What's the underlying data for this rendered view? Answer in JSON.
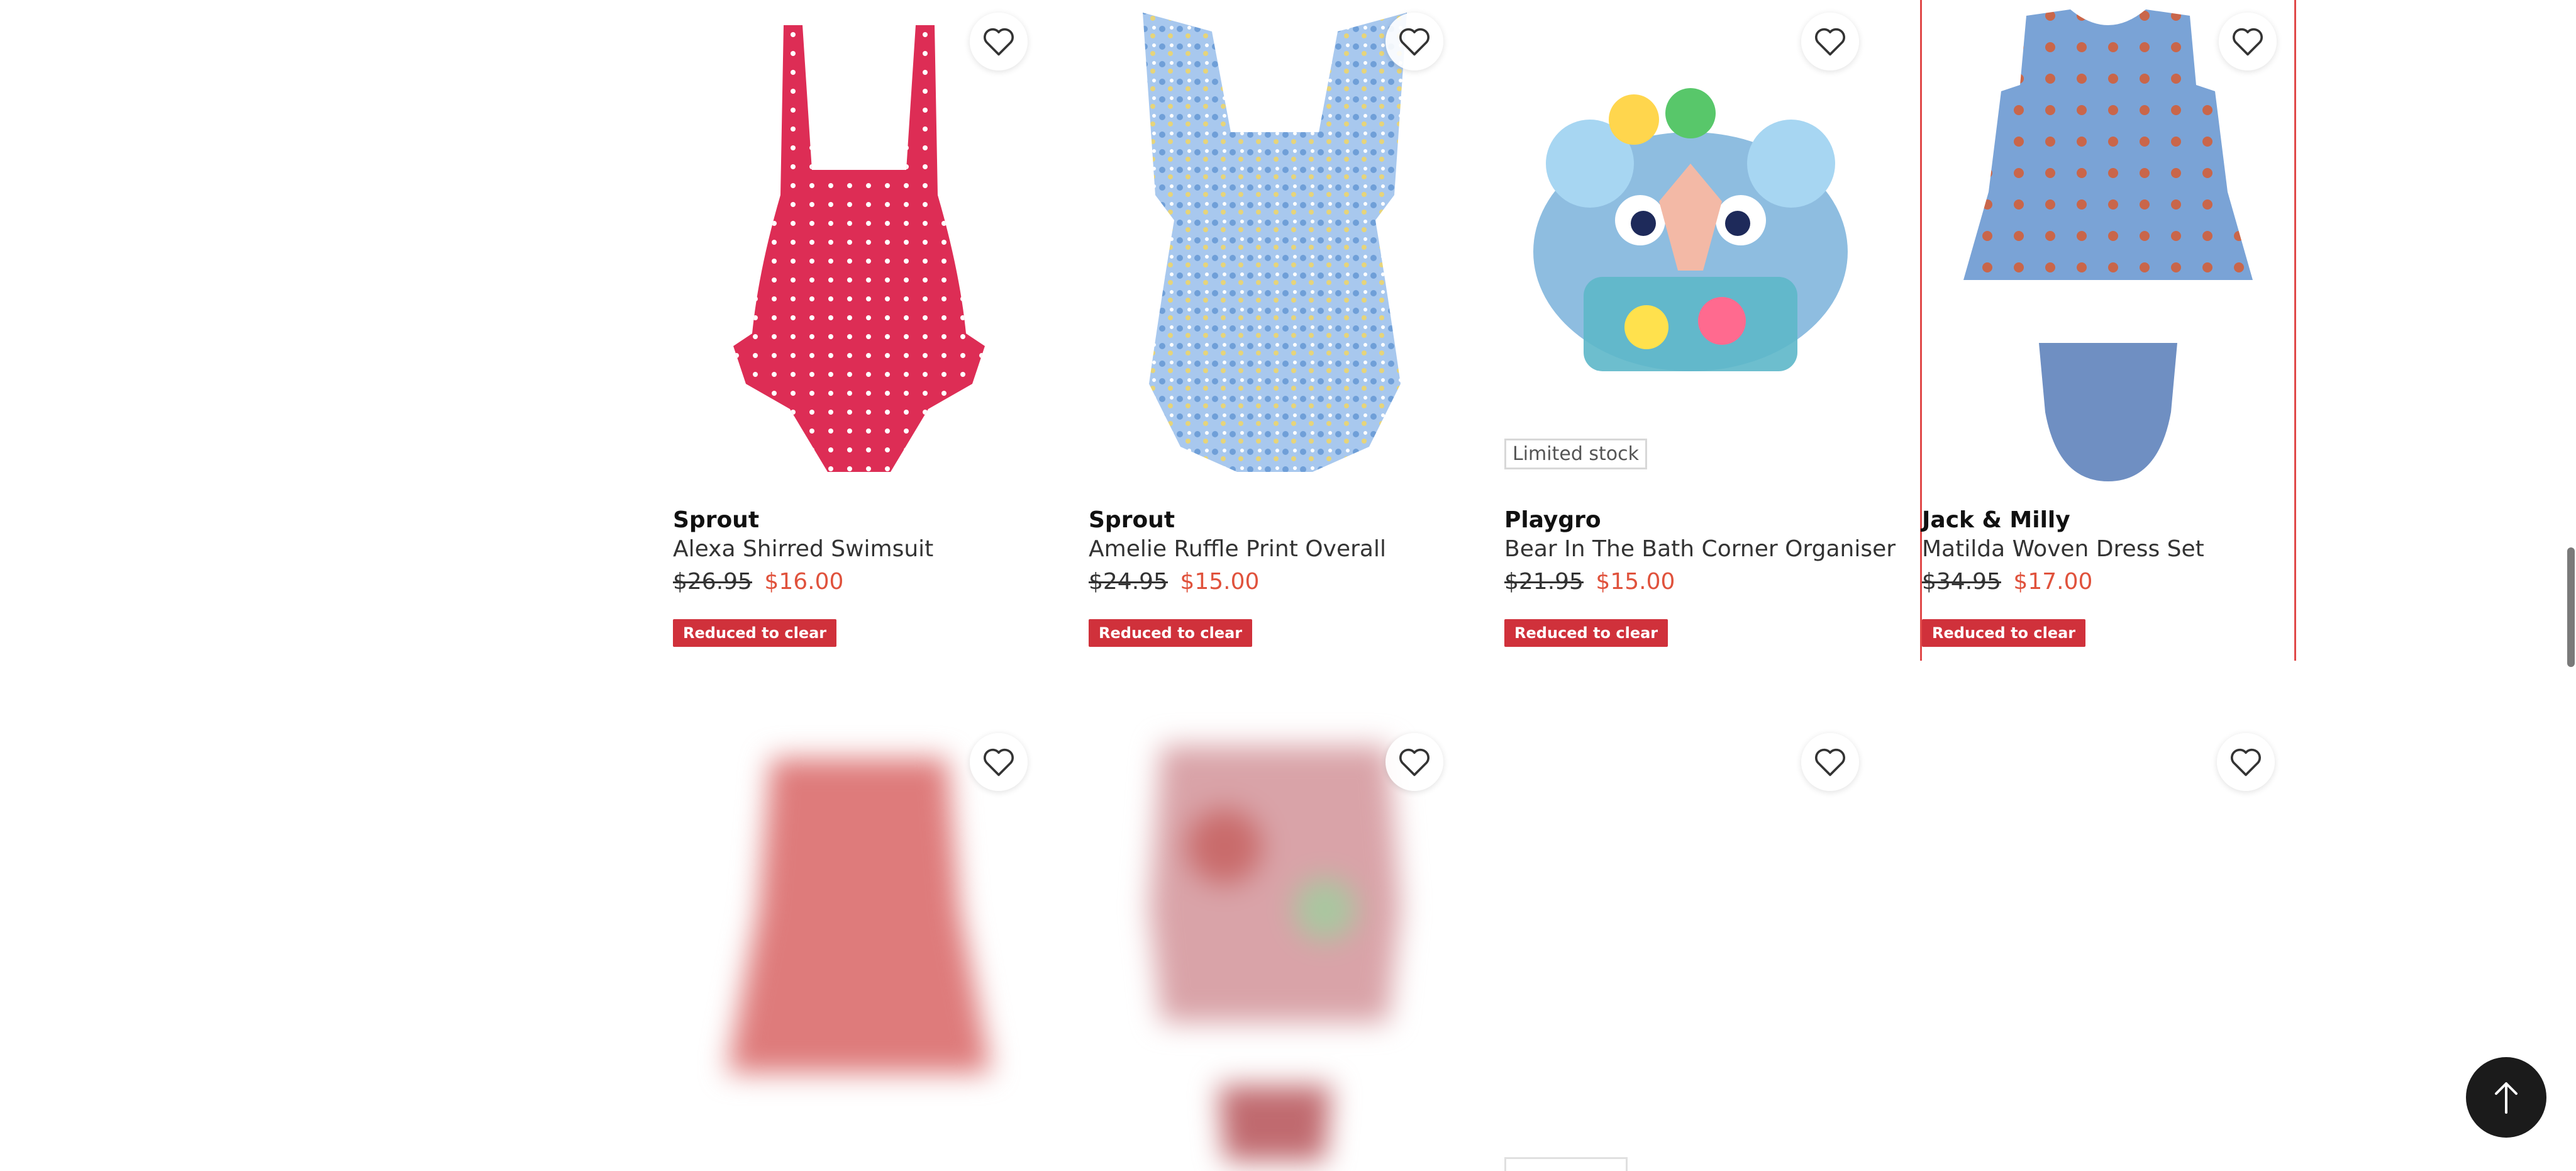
{
  "products": [
    {
      "brand": "Sprout",
      "name": "Alexa Shirred Swimsuit",
      "was": "$26.95",
      "now": "$16.00",
      "promo": "Reduced to clear",
      "badge": ""
    },
    {
      "brand": "Sprout",
      "name": "Amelie Ruffle Print Overall",
      "was": "$24.95",
      "now": "$15.00",
      "promo": "Reduced to clear",
      "badge": ""
    },
    {
      "brand": "Playgro",
      "name": "Bear In The Bath Corner Organiser",
      "was": "$21.95",
      "now": "$15.00",
      "promo": "Reduced to clear",
      "badge": "Limited stock"
    },
    {
      "brand": "Jack & Milly",
      "name": "Matilda Woven Dress Set",
      "was": "$34.95",
      "now": "$17.00",
      "promo": "Reduced to clear",
      "badge": ""
    }
  ],
  "icons": {
    "wishlist": "heart-outline-icon",
    "back_to_top": "arrow-up-icon"
  },
  "colors": {
    "sale_price": "#e0523c",
    "promo_badge": "#d0313b",
    "highlight_border": "#e04848"
  }
}
